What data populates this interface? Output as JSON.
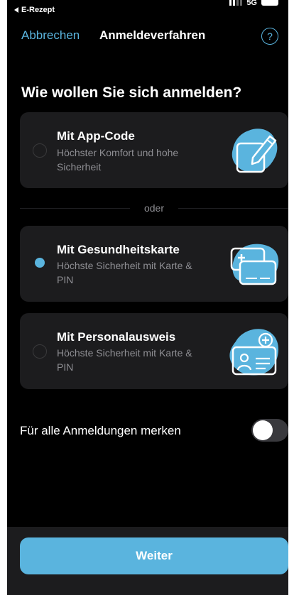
{
  "status_bar": {
    "back_app_label": "E-Rezept",
    "network": "5G"
  },
  "nav": {
    "cancel_label": "Abbrechen",
    "title": "Anmeldeverfahren",
    "help_label": "?"
  },
  "heading": "Wie wollen Sie sich anmelden?",
  "options": [
    {
      "title": "Mit App-Code",
      "description": "Höchster Komfort und hohe Sicherheit",
      "selected": false,
      "icon": "app-code-edit-icon"
    },
    {
      "title": "Mit Gesundheitskarte",
      "description": "Höchste Sicherheit mit Karte & PIN",
      "selected": true,
      "icon": "health-card-icon"
    },
    {
      "title": "Mit Personalausweis",
      "description": "Höchste Sicherheit mit Karte & PIN",
      "selected": false,
      "icon": "id-card-icon"
    }
  ],
  "divider_label": "oder",
  "remember": {
    "label": "Für alle Anmeldungen merken",
    "enabled": false
  },
  "continue_label": "Weiter",
  "colors": {
    "accent": "#5ab4de",
    "background": "#000000",
    "card": "#1c1c1e",
    "secondary_text": "#8e8e93"
  }
}
